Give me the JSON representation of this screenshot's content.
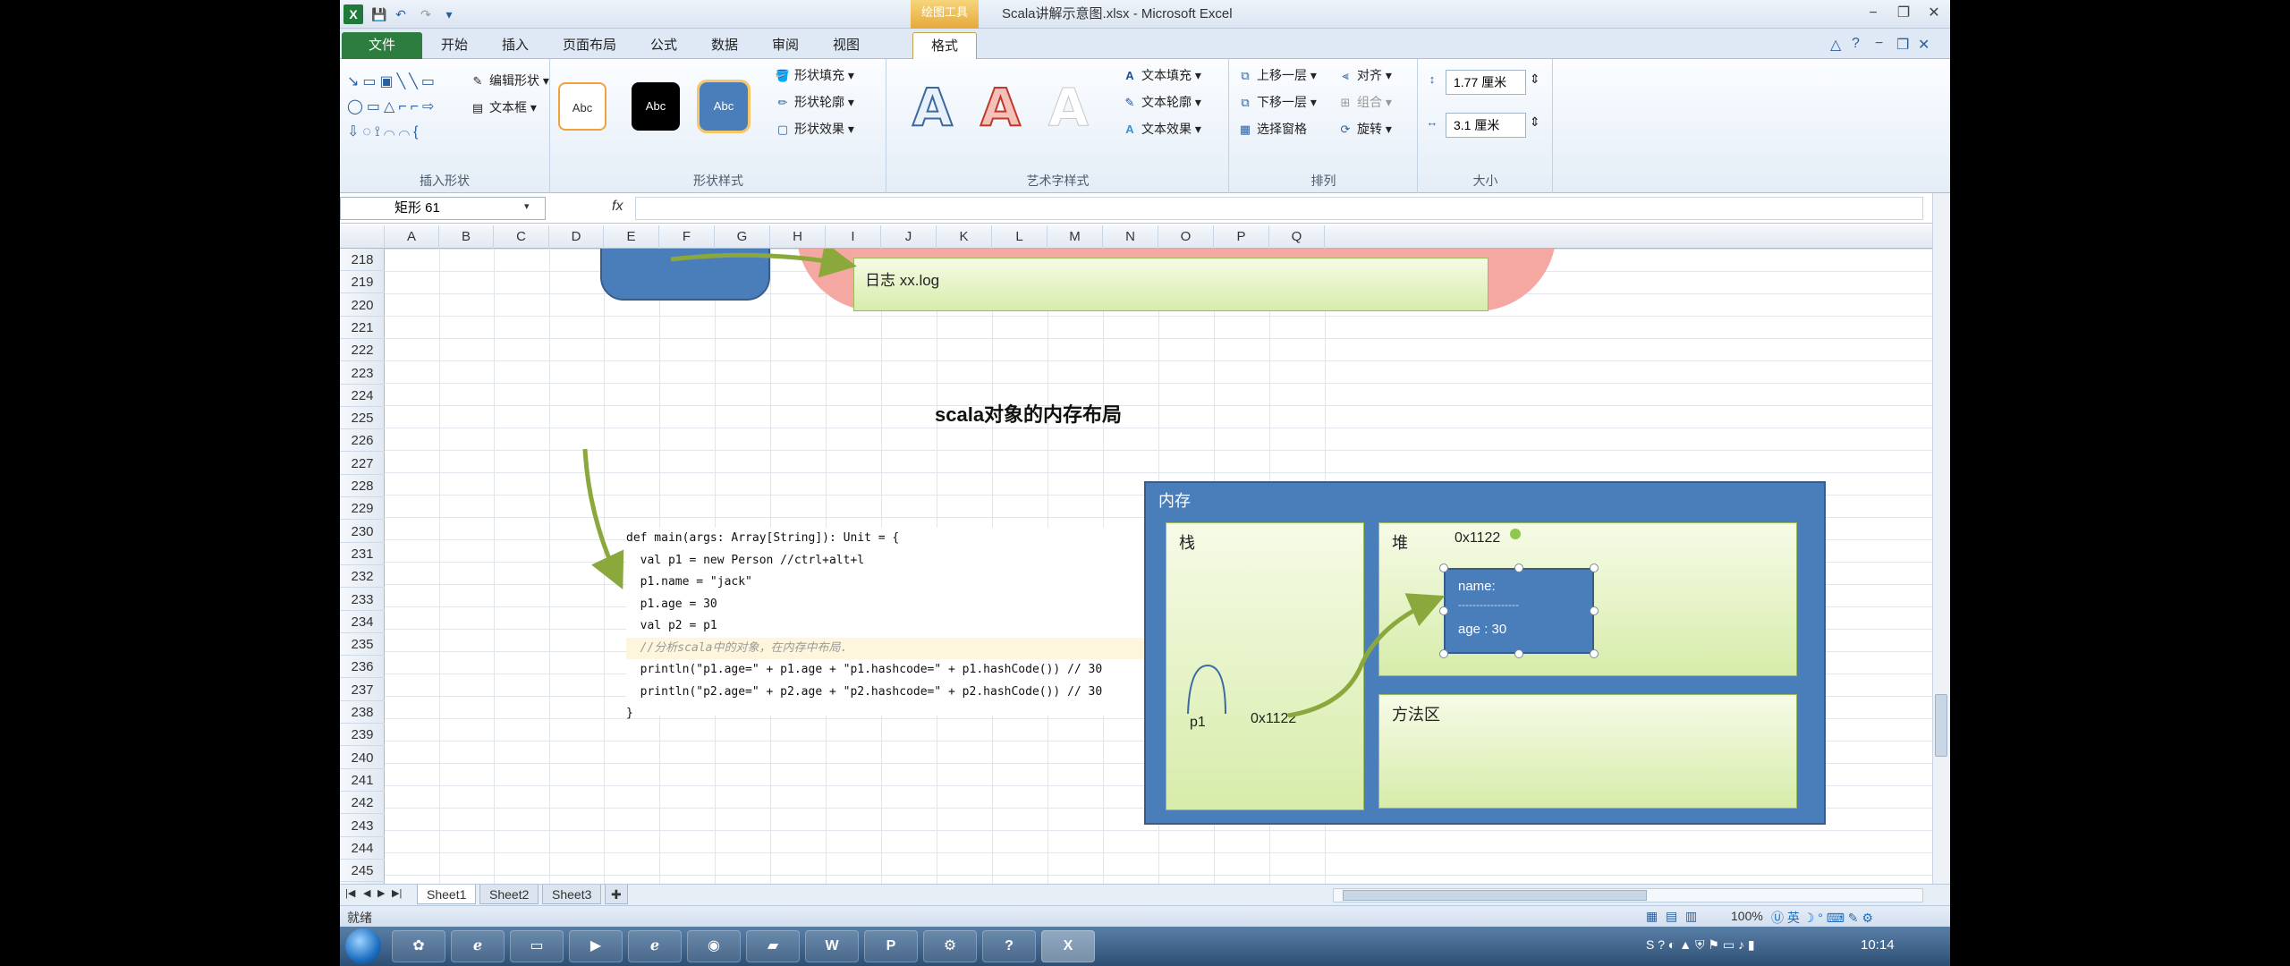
{
  "title_bar": {
    "contextual_tab_title": "绘图工具",
    "window_title": "Scala讲解示意图.xlsx - Microsoft Excel"
  },
  "ribbon_tabs": [
    "文件",
    "开始",
    "插入",
    "页面布局",
    "公式",
    "数据",
    "审阅",
    "视图",
    "格式"
  ],
  "ribbon": {
    "insert_shapes": {
      "edit_shape": "编辑形状",
      "text_box": "文本框",
      "label": "插入形状"
    },
    "shape_styles": {
      "samples": [
        "Abc",
        "Abc",
        "Abc"
      ],
      "fill": "形状填充",
      "outline": "形状轮廓",
      "effects": "形状效果",
      "label": "形状样式"
    },
    "wordart_styles": {
      "samples": [
        "A",
        "A",
        "A"
      ],
      "text_fill": "文本填充",
      "text_outline": "文本轮廓",
      "text_effects": "文本效果",
      "label": "艺术字样式"
    },
    "arrange": {
      "bring_forward": "上移一层",
      "send_backward": "下移一层",
      "selection_pane": "选择窗格",
      "align": "对齐",
      "group": "组合",
      "rotate": "旋转",
      "label": "排列"
    },
    "size": {
      "height": "1.77 厘米",
      "width": "3.1 厘米",
      "label": "大小"
    }
  },
  "formula_bar": {
    "name_box": "矩形 61",
    "fx": "fx",
    "value": ""
  },
  "columns": [
    "A",
    "B",
    "C",
    "D",
    "E",
    "F",
    "G",
    "H",
    "I",
    "J",
    "K",
    "L",
    "M",
    "N",
    "O",
    "P",
    "Q"
  ],
  "rows": [
    "218",
    "219",
    "220",
    "221",
    "222",
    "223",
    "224",
    "225",
    "226",
    "227",
    "228",
    "229",
    "230",
    "231",
    "232",
    "233",
    "234",
    "235",
    "236",
    "237",
    "238",
    "239",
    "240",
    "241",
    "242",
    "243",
    "244",
    "245"
  ],
  "sheet": {
    "log_box_text": "日志 xx.log",
    "diagram_title": "scala对象的内存布局",
    "code_lines": [
      "def main(args: Array[String]): Unit = {",
      "  val p1 = new Person //ctrl+alt+l",
      "  p1.name = \"jack\"",
      "  p1.age = 30",
      "  val p2 = p1",
      "  //分析scala中的对象，在内存中布局.",
      "  println(\"p1.age=\" + p1.age + \"p1.hashcode=\" + p1.hashCode()) // 30",
      "  println(\"p2.age=\" + p2.age + \"p2.hashcode=\" + p2.hashCode()) // 30",
      "}"
    ],
    "memory": {
      "label": "内存",
      "stack_label": "栈",
      "heap_label": "堆",
      "method_area_label": "方法区",
      "heap_address": "0x1122",
      "stack_var": "p1",
      "stack_ref": "0x1122",
      "object_name_line": "name:",
      "object_separator": "-----------------",
      "object_age_line": "age : 30"
    }
  },
  "sheet_tabs": [
    "Sheet1",
    "Sheet2",
    "Sheet3"
  ],
  "status_bar": {
    "status": "就绪",
    "zoom": "100%"
  },
  "taskbar": {
    "clock": "10:14"
  },
  "colors": {
    "excel_green": "#2d7e3e",
    "shape_blue": "#4a7ebb",
    "panel_green": "#d7ecaa",
    "pink": "#f4a8a1",
    "arrow_green": "#8aa83c"
  }
}
